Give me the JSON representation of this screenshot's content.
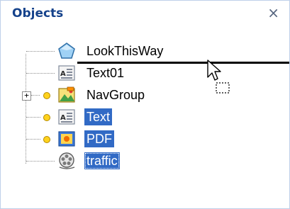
{
  "panel": {
    "title": "Objects",
    "close_glyph": "×",
    "close_icon": "close-icon"
  },
  "tree": {
    "items": [
      {
        "label": "LookThisWay",
        "icon": "shape-icon",
        "selected": false,
        "has_children": false
      },
      {
        "label": "Text01",
        "icon": "text-object-icon",
        "selected": false,
        "has_children": false
      },
      {
        "label": "NavGroup",
        "icon": "group-icon",
        "selected": false,
        "has_children": true,
        "expander": "+"
      },
      {
        "label": "Text",
        "icon": "text-object-icon",
        "selected": true,
        "has_children": false
      },
      {
        "label": "PDF",
        "icon": "pdf-object-icon",
        "selected": true,
        "has_children": false
      },
      {
        "label": "traffic",
        "icon": "video-object-icon",
        "selected": true,
        "focused": true,
        "has_children": false
      }
    ]
  },
  "colors": {
    "title": "#15428b",
    "selection": "#316ac5",
    "border": "#bfd0ea"
  },
  "drag_cursor": "drag-move-cursor-icon"
}
